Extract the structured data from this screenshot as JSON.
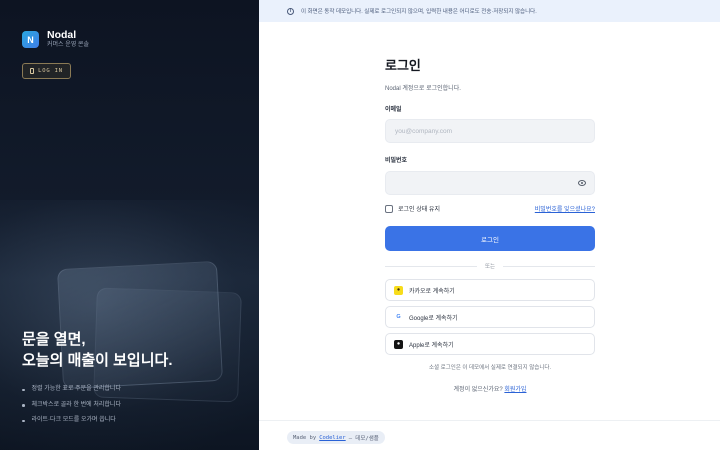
{
  "brand": {
    "logo_letter": "N",
    "name": "Nodal",
    "subtitle": "커머스 운영 콘솔"
  },
  "left": {
    "login_pill": "LOG IN",
    "hero_line1": "문을 열면,",
    "hero_line2": "오늘의 매출이 보입니다.",
    "bullets": [
      "정렬 가능한 표로 주문을 관리합니다",
      "체크박스로 골라 한 번에 처리합니다",
      "라이트·다크 모드를 오가며 씁니다"
    ]
  },
  "notice": {
    "icon": "info-icon",
    "text": "이 화면은 동작 데모입니다. 실제로 로그인되지 않으며, 입력한 내용은 어디로도 전송·저장되지 않습니다."
  },
  "form": {
    "title": "로그인",
    "subtitle": "Nodal 계정으로 로그인합니다.",
    "email_label": "이메일",
    "email_placeholder": "you@company.com",
    "email_value": "",
    "password_label": "비밀번호",
    "password_value": "",
    "remember_label": "로그인 상태 유지",
    "remember_checked": false,
    "forgot_link": "비밀번호를 잊으셨나요?",
    "submit_label": "로그인",
    "divider_label": "또는",
    "social": [
      {
        "icon": "kakao-icon",
        "glyph": "●",
        "label": "카카오로 계속하기"
      },
      {
        "icon": "google-icon",
        "glyph": "G",
        "label": "Google로 계속하기"
      },
      {
        "icon": "apple-icon",
        "glyph": "●",
        "label": "Apple로 계속하기"
      }
    ],
    "social_note": "소셜 로그인은 이 데모에서 실제로 연결되지 않습니다.",
    "signup_prompt": "계정이 없으신가요?",
    "signup_link": "회원가입"
  },
  "footer": {
    "made_by": "Made by",
    "author": "Codelier",
    "suffix": "— 데모/샘플"
  },
  "colors": {
    "primary": "#3a73e6",
    "left_bg": "#0d1422",
    "notice_bg": "#eaf1fc",
    "kakao": "#f7dc1a"
  }
}
